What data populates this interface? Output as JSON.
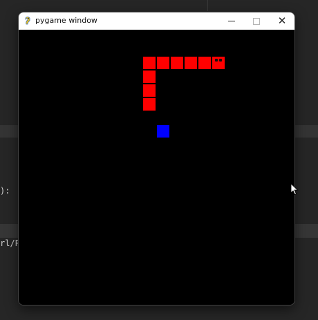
{
  "background_editor": {
    "line_fragment_1": "):",
    "line_fragment_2": "rl/P"
  },
  "window": {
    "title": "pygame window",
    "controls": {
      "minimize": "minimize",
      "maximize": "maximize",
      "close": "✕"
    }
  },
  "game": {
    "canvas_color": "#000000",
    "snake_color": "#ff0000",
    "food_color": "#0000ff",
    "snake_segments": 9,
    "direction": "right"
  },
  "icons": {
    "app": "pygame-snake-icon",
    "cursor": "mouse-pointer-icon"
  }
}
